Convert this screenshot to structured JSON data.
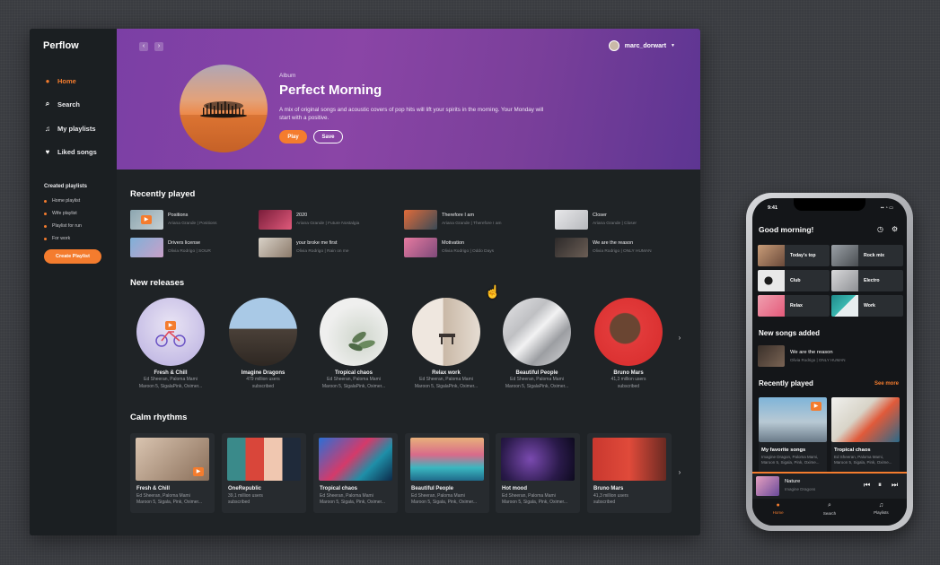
{
  "app": {
    "logo": "Perflow",
    "nav": [
      {
        "label": "Home",
        "icon": "flame-icon",
        "active": true
      },
      {
        "label": "Search",
        "icon": "search-icon"
      },
      {
        "label": "My playlists",
        "icon": "music-note-icon"
      },
      {
        "label": "Liked songs",
        "icon": "heart-icon"
      }
    ],
    "created_playlists_title": "Created playlists",
    "playlists": [
      "Home playlist",
      "Wife playlist",
      "Playlist for run",
      "For work"
    ],
    "create_playlist_label": "Create Playlist"
  },
  "header": {
    "user": "marc_dorwart",
    "album_label": "Album",
    "album_title": "Perfect Morning",
    "album_desc": "A mix of original songs and acoustic covers of pop hits will lift your spirits in the morning. Your Monday will start with a positive.",
    "play_label": "Play",
    "save_label": "Save"
  },
  "recently_played": {
    "title": "Recently played",
    "items": [
      {
        "title": "Positions",
        "artists": "Ariana Grande  |  Positions"
      },
      {
        "title": "2020",
        "artists": "Ariana Grande  |  Future Nostalgia"
      },
      {
        "title": "Therefore I am",
        "artists": "Ariana Grande  |  Therefore I am"
      },
      {
        "title": "Closer",
        "artists": "Ariana Grande  |  Closer"
      },
      {
        "title": "Drivers license",
        "artists": "Olivia Rodrigo  |  SOUR"
      },
      {
        "title": "your broke me first",
        "artists": "Olivia Rodrigo  |  Rain on me"
      },
      {
        "title": "Motivation",
        "artists": "Olivia Rodrigo  |  Oddo Days"
      },
      {
        "title": "We are the reason",
        "artists": "Olivia Rodrigo  |  ONLY HUMAN"
      }
    ]
  },
  "new_releases": {
    "title": "New releases",
    "items": [
      {
        "name": "Fresh & Chill",
        "line1": "Ed Sheeran, Paloma Mami",
        "line2": "Maroon 5, SigalaPink, Oximer..."
      },
      {
        "name": "Imagine Dragons",
        "line1": "479 million users",
        "line2": "subscribed"
      },
      {
        "name": "Tropical chaos",
        "line1": "Ed Sheeran, Paloma Mami",
        "line2": "Maroon 5, SigalaPink, Oximer..."
      },
      {
        "name": "Relax work",
        "line1": "Ed Sheeran, Paloma Mami",
        "line2": "Maroon 5, SigalaPink, Oximer..."
      },
      {
        "name": "Beautiful People",
        "line1": "Ed Sheeran, Paloma Mami",
        "line2": "Maroon 5, SigalaPink, Oximer..."
      },
      {
        "name": "Bruno Mars",
        "line1": "41,3 million users",
        "line2": "subscribed"
      }
    ]
  },
  "calm_rhythms": {
    "title": "Calm rhythms",
    "items": [
      {
        "name": "Fresh & Chill",
        "line1": "Ed Sheeran, Paloma Mami",
        "line2": "Maroon 5, Sigala, Pink, Oximer..."
      },
      {
        "name": "OneRepublic",
        "line1": "39,1 million users",
        "line2": "subscribed"
      },
      {
        "name": "Tropical chaos",
        "line1": "Ed Sheeran, Paloma Mami",
        "line2": "Maroon 5, Sigala, Pink, Oximer..."
      },
      {
        "name": "Beautiful People",
        "line1": "Ed Sheeran, Paloma Mami",
        "line2": "Maroon 5, Sigala, Pink, Oximer..."
      },
      {
        "name": "Hot mood",
        "line1": "Ed Sheeran, Paloma Mami",
        "line2": "Maroon 5, Sigala, Pink, Oximer..."
      },
      {
        "name": "Bruno Mars",
        "line1": "41,3 million users",
        "line2": "subscribed"
      }
    ]
  },
  "phone": {
    "time": "9:41",
    "greeting": "Good morning!",
    "tiles": [
      "Today's top",
      "Rock mix",
      "Club",
      "Electro",
      "Relax",
      "Work"
    ],
    "new_songs_title": "New songs added",
    "new_song": {
      "title": "We are the reason",
      "artists": "Olivia Rodrigo  |  ONLY HUMAN"
    },
    "recent_title": "Recently played",
    "see_more": "See more",
    "recent": [
      {
        "name": "My favorite songs",
        "line1": "Imagine Dragon, Paloma Mami,",
        "line2": "Maroon 5, Sigala, Pink, Oxime..."
      },
      {
        "name": "Tropical chaos",
        "line1": "Ed Sheeran, Paloma Mami,",
        "line2": "Maroon 5, Sigala, Pink, Oxime..."
      }
    ],
    "now_playing": {
      "title": "Nature",
      "artist": "Imagine Dragons"
    },
    "tabs": [
      "Home",
      "Search",
      "Playlists"
    ]
  },
  "colors": {
    "accent": "#f47c2e",
    "hero_start": "#7b3fa5",
    "hero_end": "#5d3592",
    "background": "#1f2326"
  }
}
